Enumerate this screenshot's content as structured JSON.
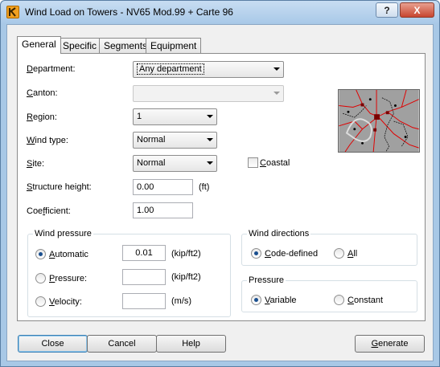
{
  "window": {
    "title": "Wind Load on Towers - NV65 Mod.99 + Carte 96",
    "help_glyph": "?",
    "close_glyph": "X"
  },
  "tabs": [
    {
      "label": "General",
      "active": true
    },
    {
      "label": "Specific",
      "active": false
    },
    {
      "label": "Segments",
      "active": false
    },
    {
      "label": "Equipment",
      "active": false
    }
  ],
  "general": {
    "department": {
      "label_pre": "",
      "label_ul": "D",
      "label_post": "epartment:",
      "value": "Any department"
    },
    "canton": {
      "label_pre": "",
      "label_ul": "C",
      "label_post": "anton:",
      "value": ""
    },
    "region": {
      "label_pre": "",
      "label_ul": "R",
      "label_post": "egion:",
      "value": "1"
    },
    "wind_type": {
      "label_pre": "",
      "label_ul": "W",
      "label_post": "ind type:",
      "value": "Normal"
    },
    "site": {
      "label_pre": "",
      "label_ul": "S",
      "label_post": "ite:",
      "value": "Normal"
    },
    "coastal": {
      "label_pre": "",
      "label_ul": "C",
      "label_post": "oastal",
      "checked": false
    },
    "structure_height": {
      "label_pre": "",
      "label_ul": "S",
      "label_post": "tructure height:",
      "value": "0.00",
      "unit": "(ft)"
    },
    "coefficient": {
      "label_pre": "Coe",
      "label_ul": "f",
      "label_post": "ficient:",
      "value": "1.00"
    }
  },
  "wind_pressure": {
    "title": "Wind pressure",
    "automatic": {
      "label_pre": "",
      "label_ul": "A",
      "label_post": "utomatic",
      "value": "0.01",
      "unit": "(kip/ft2)",
      "selected": true
    },
    "pressure": {
      "label_pre": "",
      "label_ul": "P",
      "label_post": "ressure:",
      "value": "",
      "unit": "(kip/ft2)",
      "selected": false
    },
    "velocity": {
      "label_pre": "",
      "label_ul": "V",
      "label_post": "elocity:",
      "value": "",
      "unit": "(m/s)",
      "selected": false
    }
  },
  "wind_directions": {
    "title": "Wind directions",
    "code_defined": {
      "label_pre": "",
      "label_ul": "C",
      "label_post": "ode-defined",
      "selected": true
    },
    "all": {
      "label_pre": "",
      "label_ul": "A",
      "label_post": "ll",
      "selected": false
    }
  },
  "pressure_group": {
    "title": "Pressure",
    "variable": {
      "label_pre": "",
      "label_ul": "V",
      "label_post": "ariable",
      "selected": true
    },
    "constant": {
      "label_pre": "",
      "label_ul": "C",
      "label_post": "onstant",
      "selected": false
    }
  },
  "buttons": {
    "close": "Close",
    "cancel": "Cancel",
    "help": "Help",
    "generate_pre": "",
    "generate_ul": "G",
    "generate_post": "enerate"
  },
  "colors": {
    "titlebar": "#a9c9e8",
    "map_bg": "#a0a0a0",
    "map_lines": "#e00000"
  },
  "map_icon": "region-map"
}
